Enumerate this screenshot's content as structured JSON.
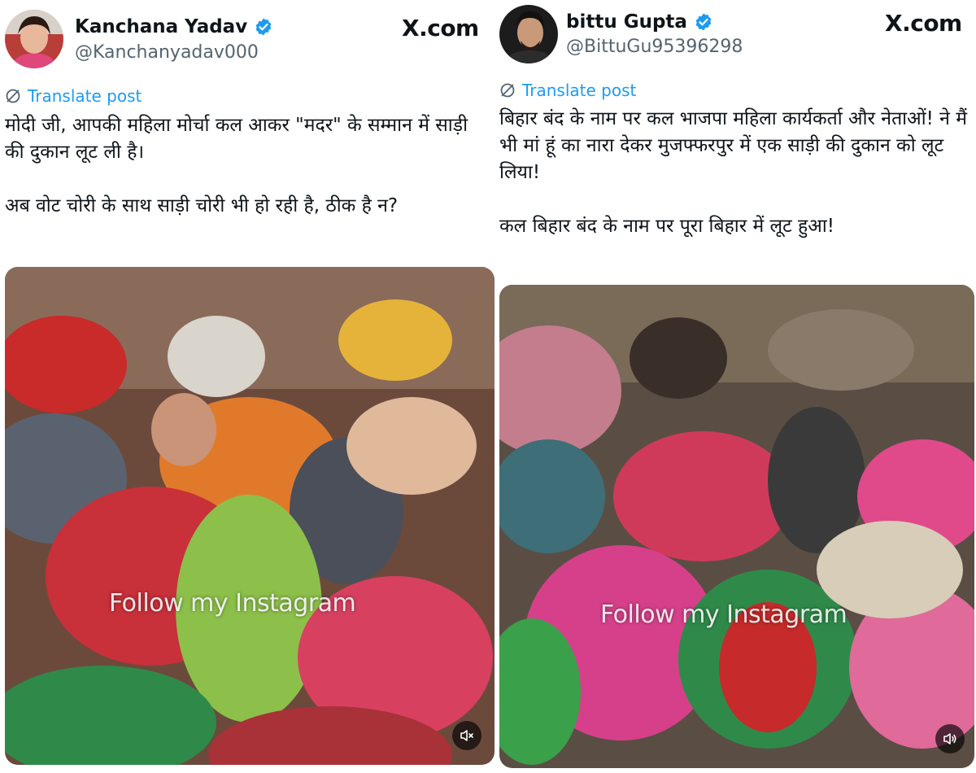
{
  "left_post": {
    "author_name": "Kanchana Yadav",
    "handle": "@Kanchanyadav000",
    "site_label": "X.com",
    "translate_label": "Translate post",
    "text_lines": [
      "मोदी जी, आपकी महिला मोर्चा कल आकर \"मदर\" के सम्मान में साड़ी की दुकान लूट ली है।",
      "अब वोट चोरी के साथ साड़ी चोरी भी हो रही है, ठीक है न?"
    ],
    "video_watermark": "Follow my Instagram",
    "icons": {
      "verified": "verified-badge-icon",
      "translate": "globe-icon",
      "mute": "speaker-muted-icon"
    }
  },
  "right_post": {
    "author_name": "bittu Gupta",
    "handle": "@BittuGu95396298",
    "site_label": "X.com",
    "translate_label": "Translate post",
    "text_lines": [
      "बिहार बंद के नाम पर कल भाजपा महिला कार्यकर्ता और नेताओं! ने मैं भी मां हूं का नारा देकर मुजफ्फरपुर में एक साड़ी की दुकान को लूट लिया!",
      "कल बिहार बंद के नाम पर पूरा बिहार में लूट हुआ!"
    ],
    "video_watermark": "Follow my Instagram",
    "icons": {
      "verified": "verified-badge-icon",
      "translate": "globe-icon",
      "volume": "speaker-icon"
    }
  },
  "colors": {
    "accent_blue": "#1d9bf0",
    "text_primary": "#0f1419",
    "text_secondary": "#536471"
  }
}
